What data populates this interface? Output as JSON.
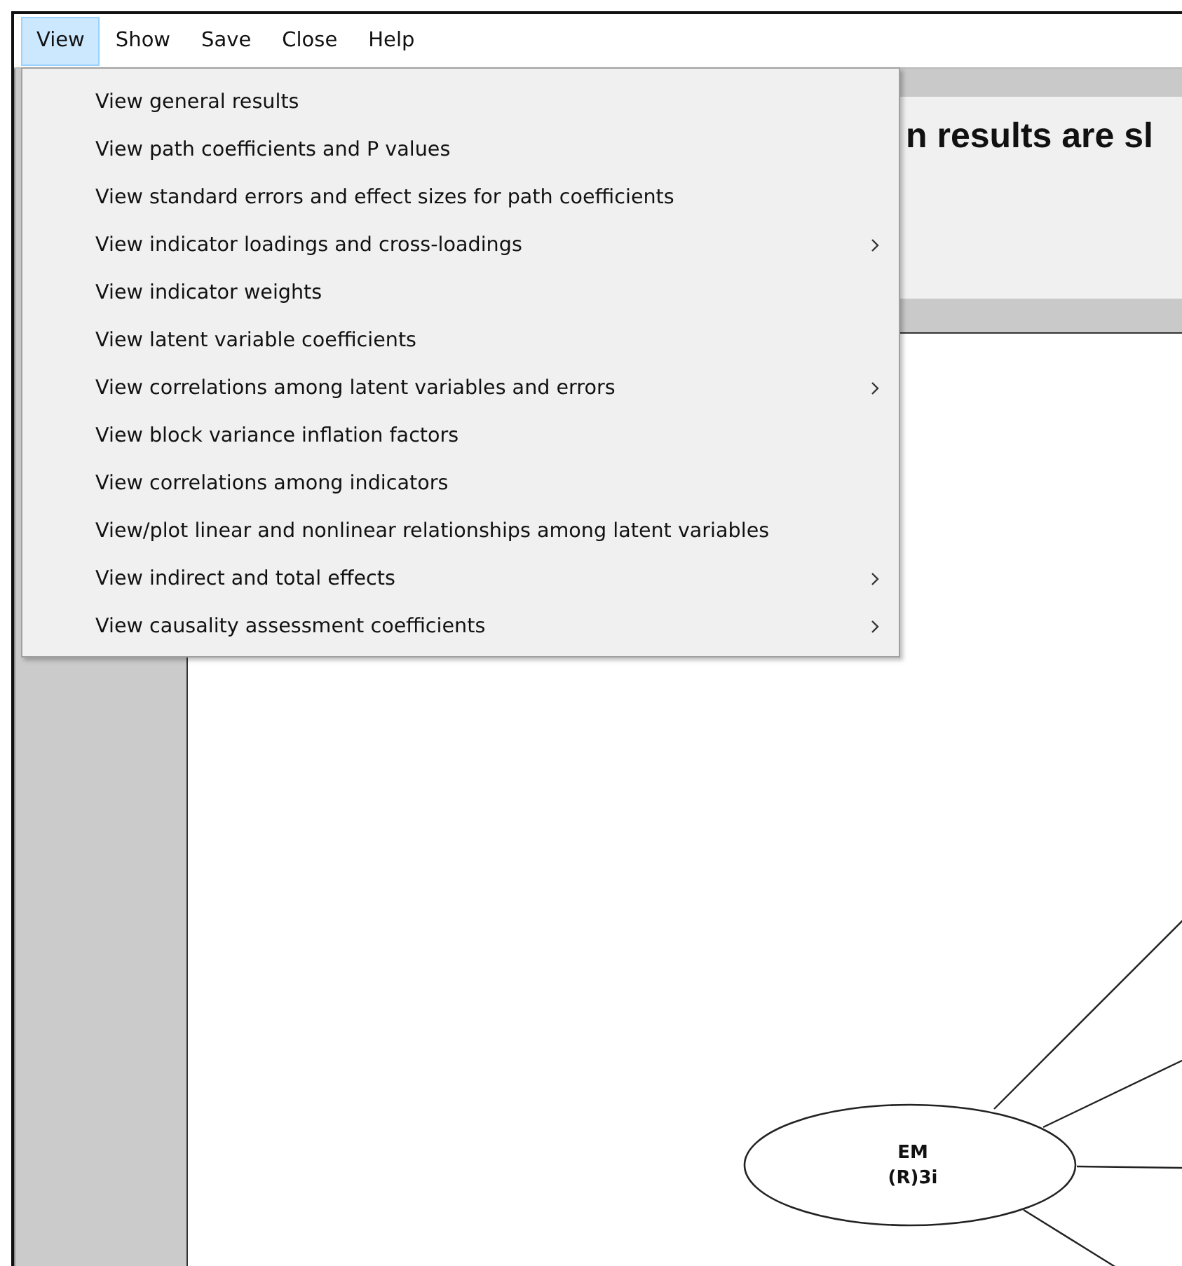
{
  "menu_bar": [
    {
      "label": "View",
      "selected": true
    },
    {
      "label": "Show",
      "selected": false
    },
    {
      "label": "Save",
      "selected": false
    },
    {
      "label": "Close",
      "selected": false
    },
    {
      "label": "Help",
      "selected": false
    }
  ],
  "view_menu": [
    {
      "label": "View general results",
      "submenu": false
    },
    {
      "label": "View path coefficients and P values",
      "submenu": false
    },
    {
      "label": "View standard errors and effect sizes for path coefficients",
      "submenu": false
    },
    {
      "label": "View indicator loadings and cross-loadings",
      "submenu": true
    },
    {
      "label": "View indicator weights",
      "submenu": false
    },
    {
      "label": "View latent variable coefficients",
      "submenu": false
    },
    {
      "label": "View correlations among latent variables and errors",
      "submenu": true
    },
    {
      "label": "View block variance inflation factors",
      "submenu": false
    },
    {
      "label": "View correlations among indicators",
      "submenu": false
    },
    {
      "label": "View/plot linear and nonlinear relationships among latent variables",
      "submenu": false
    },
    {
      "label": "View indirect and total effects",
      "submenu": true
    },
    {
      "label": "View causality assessment coefficients",
      "submenu": true
    }
  ],
  "header": {
    "title": "n results are sl"
  },
  "diagram": {
    "node": {
      "name": "EM",
      "detail": "(R)3i"
    }
  }
}
